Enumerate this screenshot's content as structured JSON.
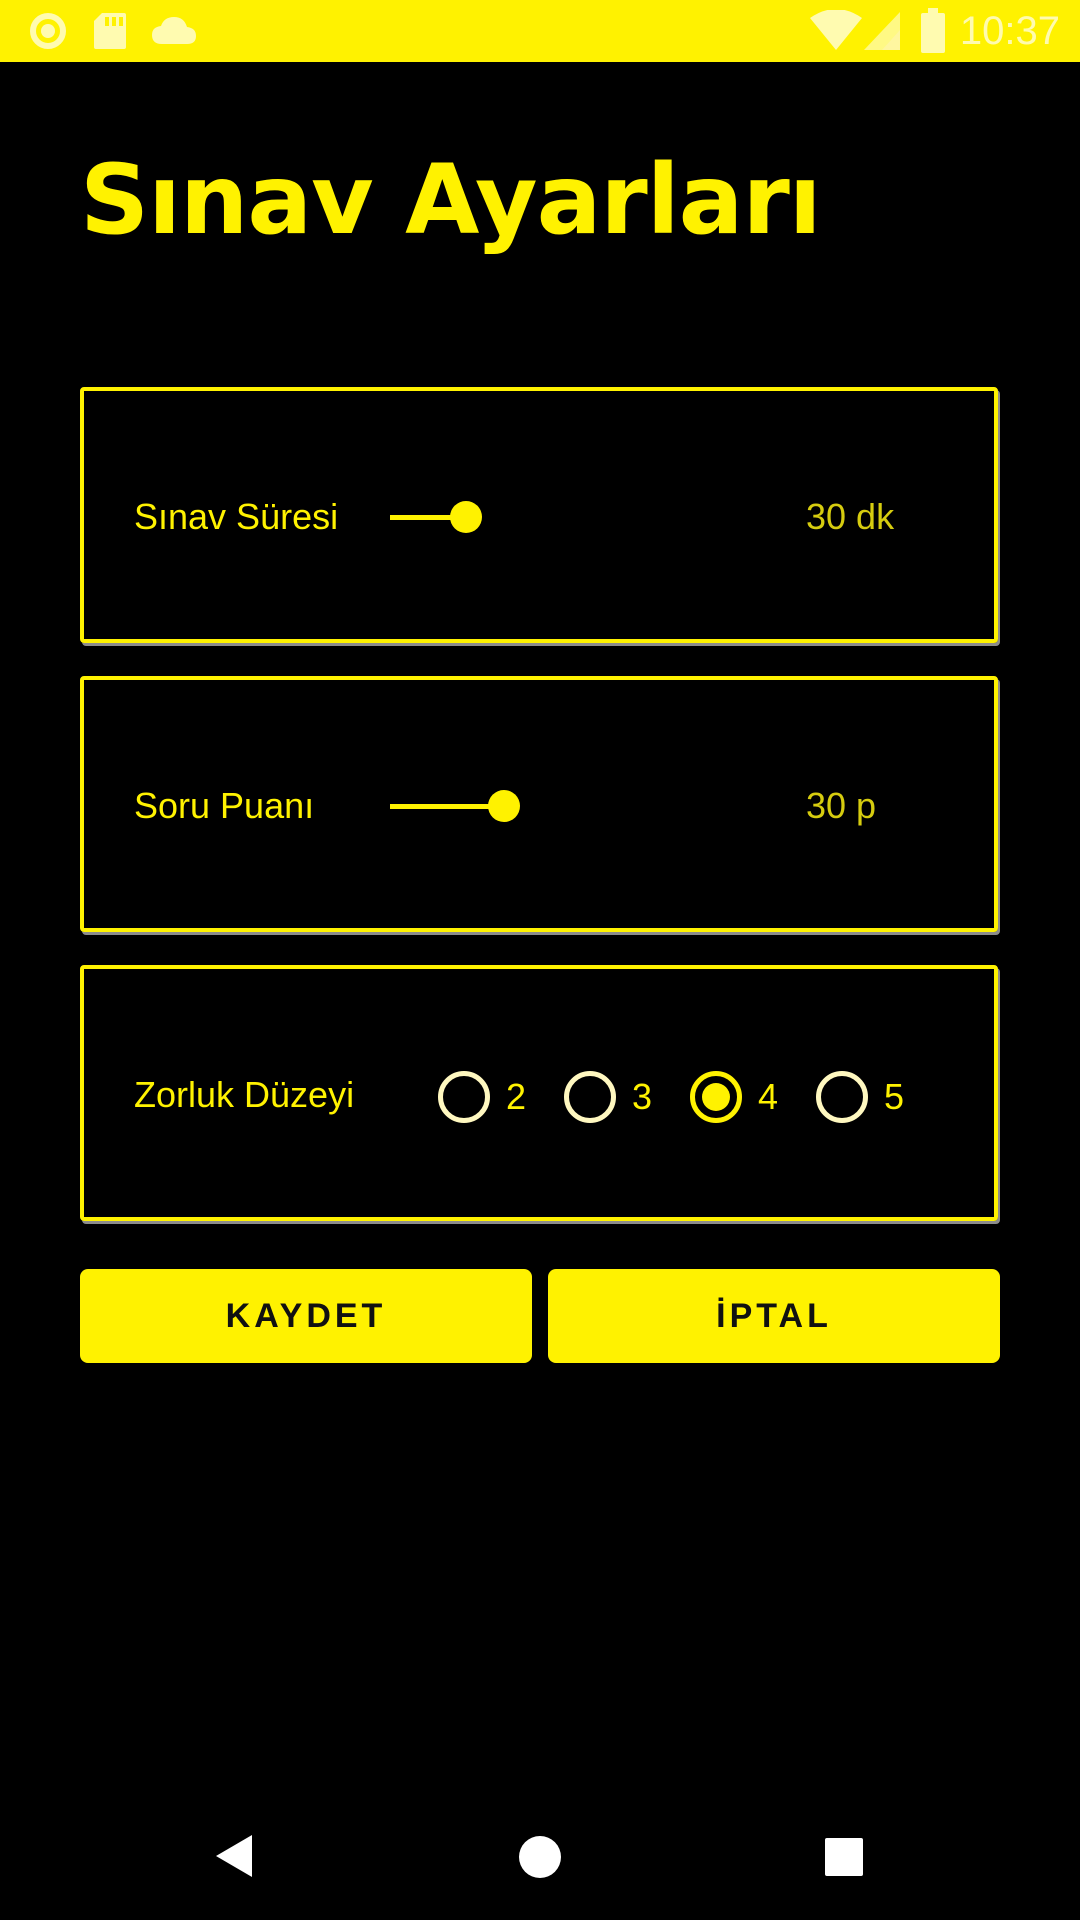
{
  "status_bar": {
    "time": "10:37",
    "left_icons": [
      "circle-status-icon",
      "sd-card-icon",
      "cloud-icon"
    ],
    "right_icons": [
      "wifi-icon",
      "cellular-signal-icon",
      "battery-icon"
    ],
    "background_color": "#FFF200"
  },
  "page": {
    "title": "Sınav Ayarları",
    "accent_color": "#FFF200",
    "background_color": "#000000"
  },
  "settings": {
    "duration": {
      "label": "Sınav Süresi",
      "value_text": "30 dk",
      "slider_fraction": 0.4
    },
    "score": {
      "label": "Soru Puanı",
      "value_text": "30 p",
      "slider_fraction": 0.6
    },
    "difficulty": {
      "label": "Zorluk Düzeyi",
      "options": [
        "2",
        "3",
        "4",
        "5"
      ],
      "selected": "4"
    }
  },
  "actions": {
    "save_label": "KAYDET",
    "cancel_label": "İPTAL"
  },
  "nav_bar": {
    "icons": [
      "back-icon",
      "home-icon",
      "recents-icon"
    ]
  }
}
